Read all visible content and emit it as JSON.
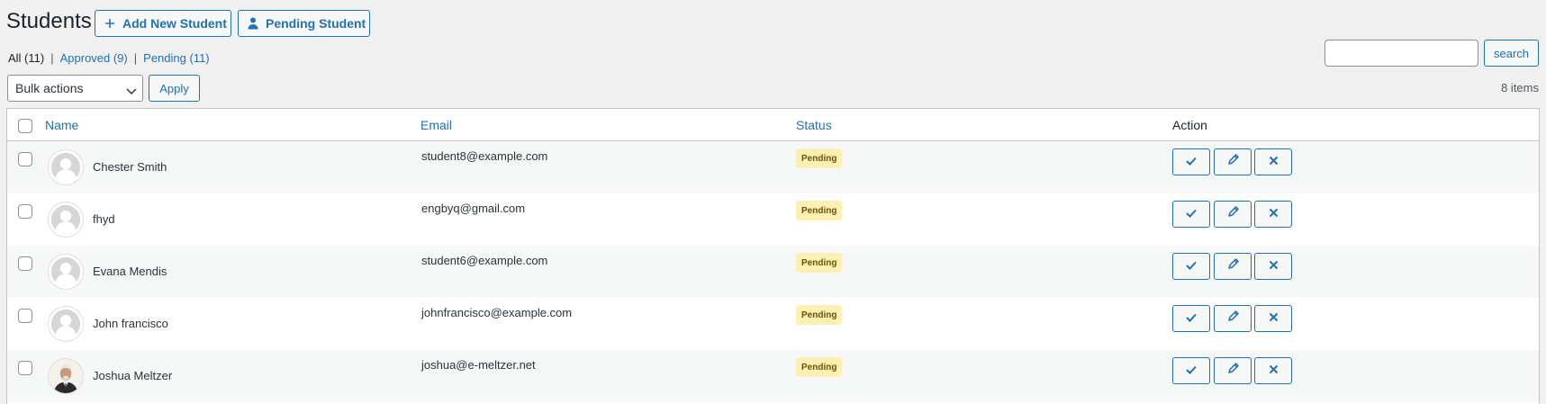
{
  "page": {
    "title": "Students",
    "add_button": "Add New Student",
    "pending_button": "Pending Student"
  },
  "filters": {
    "all": "All (11)",
    "approved": "Approved (9)",
    "pending": "Pending (11)",
    "separator": "|"
  },
  "search": {
    "value": "",
    "button": "search"
  },
  "bulk": {
    "selected": "Bulk actions",
    "apply": "Apply"
  },
  "items_count": "8 items",
  "table": {
    "columns": {
      "name": "Name",
      "email": "Email",
      "status": "Status",
      "action": "Action"
    },
    "rows": [
      {
        "name": "Chester Smith",
        "email": "student8@example.com",
        "status": "Pending",
        "avatar": "default-avatar"
      },
      {
        "name": "fhyd",
        "email": "engbyq@gmail.com",
        "status": "Pending",
        "avatar": "default-avatar"
      },
      {
        "name": "Evana Mendis",
        "email": "student6@example.com",
        "status": "Pending",
        "avatar": "default-avatar"
      },
      {
        "name": "John francisco",
        "email": "johnfrancisco@example.com",
        "status": "Pending",
        "avatar": "default-avatar"
      },
      {
        "name": "Joshua Meltzer",
        "email": "joshua@e-meltzer.net",
        "status": "Pending",
        "avatar": "photo-avatar"
      }
    ]
  },
  "colors": {
    "accent": "#2271b1",
    "badge_bg": "#fcf0b5",
    "page_bg": "#f0f0f1"
  },
  "icons": {
    "add": "plus-icon",
    "pending": "user-icon",
    "approve": "check-icon",
    "edit": "pencil-icon",
    "delete": "close-icon"
  }
}
